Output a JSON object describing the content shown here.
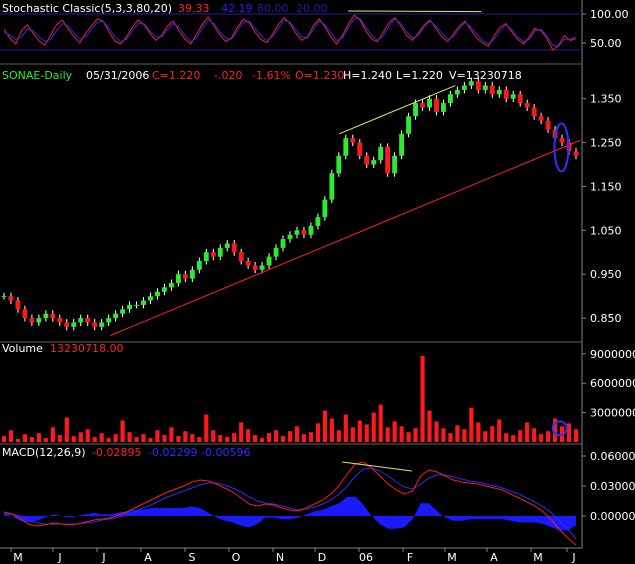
{
  "chart_data": [
    {
      "type": "line",
      "panel": "stochastic",
      "title": "Stochastic Classic(5,3,3,80,20)",
      "header_values": {
        "k": "39.33",
        "d": "42.19",
        "overbought": "80.00",
        "oversold": "20.00"
      },
      "header_colors": {
        "k": "#ff2020",
        "d": "#2020ff",
        "levels": "#2020a0"
      },
      "y_ticks": [
        "100.00",
        "50.00"
      ],
      "ylim": [
        0,
        100
      ],
      "levels": [
        80,
        20
      ],
      "series": [
        {
          "color": "#ff1a1a",
          "values": [
            55,
            40,
            30,
            52,
            62,
            48,
            35,
            28,
            45,
            62,
            70,
            55,
            42,
            32,
            48,
            60,
            72,
            68,
            50,
            35,
            30,
            42,
            58,
            70,
            62,
            48,
            36,
            44,
            60,
            68,
            52,
            38,
            30,
            46,
            63,
            75,
            60,
            45,
            34,
            40,
            58,
            71,
            66,
            50,
            38,
            32,
            46,
            62,
            74,
            64,
            48,
            36,
            42,
            60,
            72,
            58,
            42,
            30,
            44,
            64,
            78,
            70,
            52,
            38,
            34,
            50,
            66,
            74,
            60,
            44,
            36,
            48,
            62,
            70,
            56,
            42,
            34,
            46,
            60,
            68,
            54,
            40,
            32,
            26,
            44,
            58,
            64,
            50,
            38,
            30,
            42,
            56,
            52,
            40,
            20,
            28,
            44,
            36,
            39
          ]
        },
        {
          "color": "#2b2bff",
          "values": [
            50,
            45,
            38,
            42,
            55,
            52,
            42,
            34,
            38,
            52,
            64,
            60,
            48,
            38,
            42,
            54,
            66,
            68,
            56,
            42,
            34,
            38,
            52,
            64,
            64,
            52,
            42,
            42,
            54,
            64,
            58,
            44,
            34,
            40,
            56,
            70,
            64,
            50,
            40,
            38,
            52,
            66,
            68,
            56,
            44,
            36,
            42,
            56,
            70,
            66,
            54,
            42,
            40,
            54,
            68,
            62,
            48,
            36,
            40,
            58,
            72,
            72,
            58,
            44,
            36,
            44,
            60,
            72,
            64,
            50,
            40,
            44,
            58,
            68,
            60,
            48,
            38,
            42,
            56,
            66,
            58,
            46,
            36,
            30,
            38,
            52,
            62,
            54,
            42,
            34,
            38,
            52,
            54,
            44,
            28,
            26,
            38,
            38,
            42
          ]
        }
      ],
      "trendline": {
        "color": "#e8e860",
        "points": [
          [
            0.6,
            85
          ],
          [
            0.83,
            84
          ]
        ]
      }
    },
    {
      "type": "line",
      "panel": "price",
      "title": "SONAE-Daily",
      "date": "05/31/2006",
      "ohlc_text": {
        "c": "C=1.220",
        "chg": "-.020",
        "pct": "-1.61%",
        "o": "O=1.230",
        "h": "H=1.240",
        "l": "L=1.220",
        "v": "V=13230718"
      },
      "header_colors": {
        "title": "#2eea2e",
        "date": "#ffffff",
        "c": "#ff2020",
        "chg": "#ff2020",
        "pct": "#ff2020",
        "o": "#ff2020",
        "h": "#ffffff",
        "l": "#ffffff",
        "v": "#ffffff"
      },
      "y_ticks": [
        "1.350",
        "1.250",
        "1.150",
        "1.050",
        "0.950",
        "0.850"
      ],
      "ylim": [
        0.8,
        1.42
      ],
      "close": [
        0.9,
        0.89,
        0.87,
        0.85,
        0.84,
        0.85,
        0.86,
        0.85,
        0.84,
        0.83,
        0.84,
        0.85,
        0.84,
        0.83,
        0.84,
        0.85,
        0.86,
        0.87,
        0.88,
        0.88,
        0.89,
        0.9,
        0.91,
        0.92,
        0.93,
        0.95,
        0.94,
        0.96,
        0.98,
        1.0,
        0.99,
        1.01,
        1.02,
        1.0,
        0.98,
        0.97,
        0.96,
        0.97,
        0.99,
        1.01,
        1.03,
        1.04,
        1.05,
        1.04,
        1.06,
        1.08,
        1.12,
        1.18,
        1.22,
        1.26,
        1.25,
        1.22,
        1.2,
        1.21,
        1.24,
        1.18,
        1.22,
        1.27,
        1.31,
        1.34,
        1.33,
        1.35,
        1.32,
        1.34,
        1.36,
        1.37,
        1.38,
        1.39,
        1.37,
        1.38,
        1.36,
        1.37,
        1.35,
        1.36,
        1.34,
        1.33,
        1.31,
        1.3,
        1.28,
        1.26,
        1.25,
        1.23,
        1.22
      ],
      "trendlines": [
        {
          "color": "#ff2020",
          "from": [
            0.19,
            0.81
          ],
          "to": [
            1.0,
            1.255
          ]
        },
        {
          "color": "#e8e860",
          "from": [
            0.585,
            1.27
          ],
          "to": [
            0.785,
            1.38
          ]
        }
      ],
      "highlight": {
        "color": "#3030ff",
        "cx": 0.968,
        "cy": 1.23
      }
    },
    {
      "type": "bar",
      "panel": "volume",
      "title": "Volume",
      "header_value": "13230718.00",
      "header_colors": {
        "title": "#ffffff",
        "value": "#ff2020"
      },
      "y_ticks": [
        "9000000",
        "6000000",
        "3000000"
      ],
      "ylim": [
        0,
        10000000
      ],
      "values": [
        600000,
        1200000,
        300000,
        800000,
        500000,
        900000,
        400000,
        1500000,
        700000,
        2500000,
        600000,
        1000000,
        1300000,
        500000,
        900000,
        400000,
        800000,
        2200000,
        1000000,
        500000,
        800000,
        400000,
        1200000,
        700000,
        1500000,
        600000,
        1100000,
        800000,
        500000,
        2800000,
        1200000,
        700000,
        500000,
        900000,
        2000000,
        1300000,
        700000,
        400000,
        900000,
        1200000,
        600000,
        1100000,
        1600000,
        800000,
        1000000,
        1900000,
        3200000,
        2400000,
        1200000,
        2800000,
        1500000,
        2200000,
        1800000,
        3000000,
        3800000,
        1500000,
        2100000,
        1600000,
        1000000,
        1400000,
        8800000,
        3200000,
        2100000,
        1400000,
        900000,
        1700000,
        1300000,
        3500000,
        2000000,
        1100000,
        1600000,
        2300000,
        900000,
        700000,
        1200000,
        2000000,
        1400000,
        800000,
        1100000,
        2400000,
        1600000,
        1900000,
        1300000
      ],
      "series_color": "#ff1a1a",
      "highlight": {
        "color": "#3030ff",
        "cx": 0.965,
        "value": 1400000
      }
    },
    {
      "type": "line",
      "panel": "macd",
      "title": "MACD(12,26,9)",
      "header_values": {
        "macd": "-0.02895",
        "signal": "-0.02299",
        "hist": "-0.00596"
      },
      "header_colors": {
        "macd": "#ff2020",
        "signal": "#2b2bff",
        "hist": "#2b2bff"
      },
      "y_ticks": [
        "0.06000",
        "0.03000",
        "0.00000"
      ],
      "ylim": [
        -0.03,
        0.07
      ],
      "macd": [
        0.004,
        0.002,
        -0.003,
        -0.008,
        -0.01,
        -0.009,
        -0.007,
        -0.008,
        -0.009,
        -0.008,
        -0.006,
        -0.004,
        -0.003,
        -0.002,
        0.001,
        0.004,
        0.008,
        0.012,
        0.016,
        0.02,
        0.024,
        0.027,
        0.03,
        0.034,
        0.036,
        0.035,
        0.032,
        0.028,
        0.024,
        0.018,
        0.012,
        0.01,
        0.012,
        0.011,
        0.008,
        0.006,
        0.005,
        0.008,
        0.012,
        0.016,
        0.022,
        0.03,
        0.042,
        0.052,
        0.054,
        0.048,
        0.04,
        0.032,
        0.026,
        0.022,
        0.025,
        0.04,
        0.046,
        0.044,
        0.04,
        0.036,
        0.034,
        0.033,
        0.032,
        0.03,
        0.028,
        0.026,
        0.022,
        0.018,
        0.014,
        0.01,
        0.004,
        -0.004,
        -0.014,
        -0.022,
        -0.029
      ],
      "signal": [
        0.002,
        0.002,
        0.0,
        -0.004,
        -0.007,
        -0.008,
        -0.008,
        -0.008,
        -0.008,
        -0.008,
        -0.007,
        -0.006,
        -0.004,
        -0.003,
        -0.001,
        0.001,
        0.004,
        0.008,
        0.011,
        0.015,
        0.019,
        0.022,
        0.025,
        0.028,
        0.031,
        0.033,
        0.033,
        0.031,
        0.028,
        0.024,
        0.019,
        0.015,
        0.013,
        0.012,
        0.01,
        0.008,
        0.006,
        0.007,
        0.009,
        0.012,
        0.016,
        0.022,
        0.03,
        0.04,
        0.047,
        0.048,
        0.045,
        0.04,
        0.034,
        0.029,
        0.027,
        0.032,
        0.038,
        0.041,
        0.041,
        0.039,
        0.037,
        0.035,
        0.034,
        0.032,
        0.03,
        0.028,
        0.025,
        0.022,
        0.018,
        0.014,
        0.009,
        0.003,
        -0.005,
        -0.013,
        -0.023
      ],
      "trendline": {
        "color": "#e8e860",
        "points": [
          [
            0.59,
            0.054
          ],
          [
            0.71,
            0.045
          ]
        ]
      },
      "hist_color": "#1a1aff"
    }
  ],
  "x_axis": {
    "labels": [
      "M",
      "J",
      "J",
      "A",
      "S",
      "O",
      "N",
      "D",
      "06",
      "F",
      "M",
      "A",
      "M",
      "J"
    ]
  }
}
